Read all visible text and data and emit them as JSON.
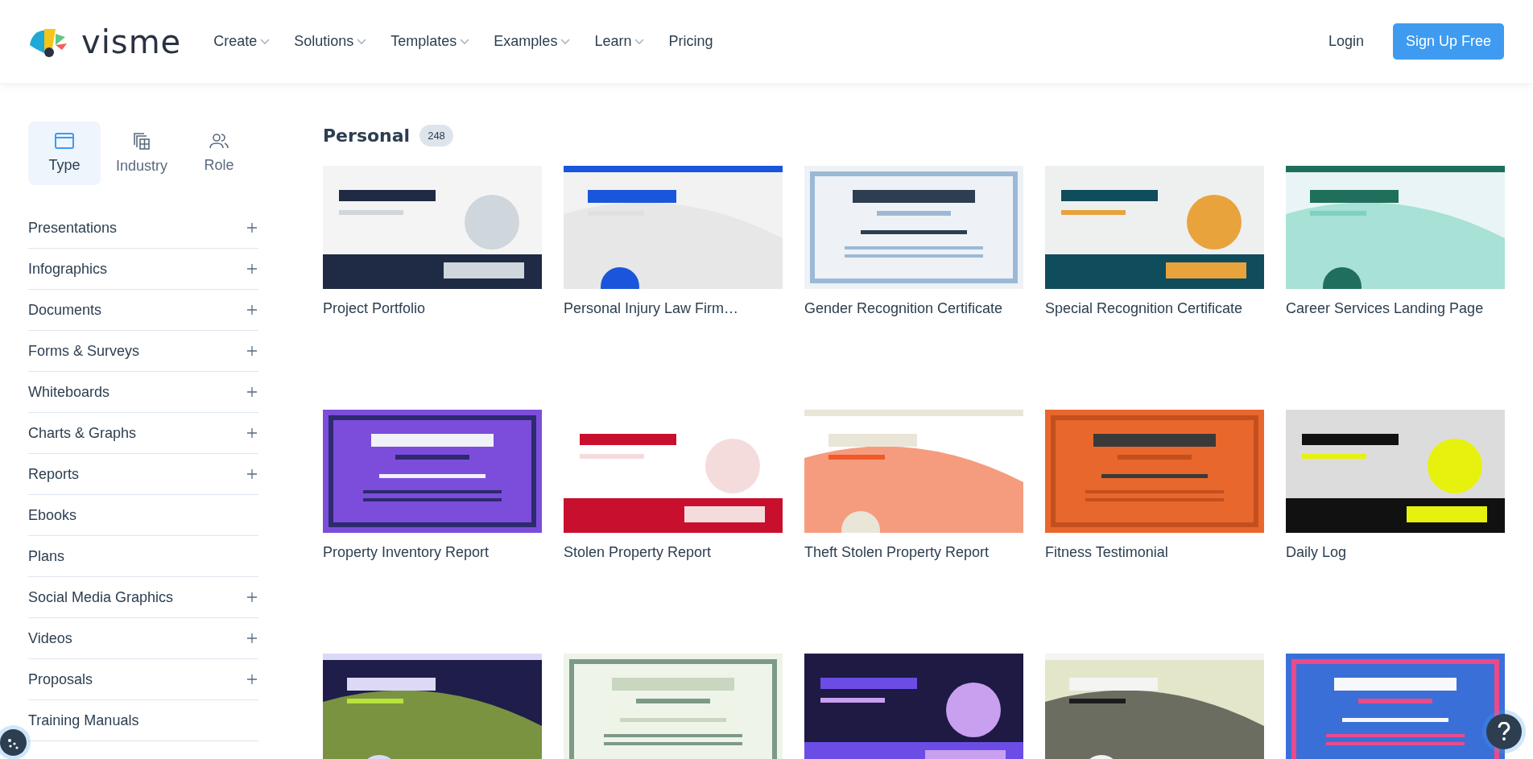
{
  "header": {
    "logo": "visme",
    "nav": [
      {
        "label": "Create",
        "dropdown": true
      },
      {
        "label": "Solutions",
        "dropdown": true
      },
      {
        "label": "Templates",
        "dropdown": true
      },
      {
        "label": "Examples",
        "dropdown": true
      },
      {
        "label": "Learn",
        "dropdown": true
      },
      {
        "label": "Pricing",
        "dropdown": false
      }
    ],
    "login": "Login",
    "signup": "Sign Up Free"
  },
  "sidebar": {
    "tabs": [
      {
        "label": "Type",
        "kind": "type",
        "selected": true
      },
      {
        "label": "Industry",
        "kind": "industry",
        "selected": false
      },
      {
        "label": "Role",
        "kind": "role",
        "selected": false
      }
    ],
    "items": [
      {
        "label": "Presentations",
        "expandable": true
      },
      {
        "label": "Infographics",
        "expandable": true
      },
      {
        "label": "Documents",
        "expandable": true
      },
      {
        "label": "Forms & Surveys",
        "expandable": true
      },
      {
        "label": "Whiteboards",
        "expandable": true
      },
      {
        "label": "Charts & Graphs",
        "expandable": true
      },
      {
        "label": "Reports",
        "expandable": true
      },
      {
        "label": "Ebooks",
        "expandable": false
      },
      {
        "label": "Plans",
        "expandable": false
      },
      {
        "label": "Social Media Graphics",
        "expandable": true
      },
      {
        "label": "Videos",
        "expandable": true
      },
      {
        "label": "Proposals",
        "expandable": true
      },
      {
        "label": "Training Manuals",
        "expandable": false
      }
    ]
  },
  "section": {
    "title": "Personal",
    "count": "248"
  },
  "templates": [
    {
      "title": "Project Portfolio",
      "kind": "picture"
    },
    {
      "title": "Personal Injury Law Firm…",
      "kind": "picture"
    },
    {
      "title": "Gender Recognition Certificate",
      "kind": "picture"
    },
    {
      "title": "Special Recognition Certificate",
      "kind": "picture"
    },
    {
      "title": "Career Services Landing Page",
      "kind": "picture"
    },
    {
      "title": "Property Inventory Report",
      "kind": "picture"
    },
    {
      "title": "Stolen Property Report",
      "kind": "picture"
    },
    {
      "title": "Theft Stolen Property Report",
      "kind": "picture"
    },
    {
      "title": "Fitness Testimonial",
      "kind": "picture"
    },
    {
      "title": "Daily Log",
      "kind": "picture"
    },
    {
      "kind": "picture"
    },
    {
      "kind": "picture"
    },
    {
      "kind": "picture"
    },
    {
      "kind": "picture"
    },
    {
      "kind": "picture"
    }
  ]
}
